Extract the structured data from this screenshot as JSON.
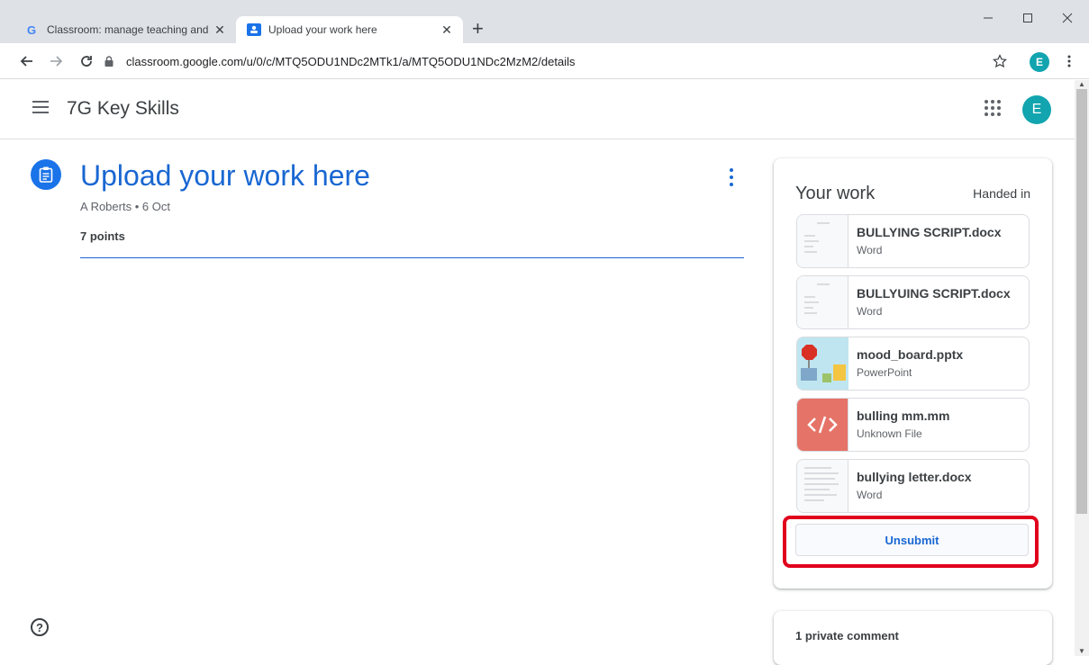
{
  "browser": {
    "tabs": [
      {
        "title": "Classroom: manage teaching and",
        "icon": "google-icon"
      },
      {
        "title": "Upload your work here",
        "icon": "classroom-icon"
      }
    ],
    "new_tab": "+",
    "url": "classroom.google.com/u/0/c/MTQ5ODU1NDc2MTk1/a/MTQ5ODU1NDc2MzM2/details",
    "profile_initial": "E"
  },
  "header": {
    "course_name": "7G Key Skills",
    "avatar_initial": "E"
  },
  "assignment": {
    "title": "Upload your work here",
    "meta": "A Roberts • 6 Oct",
    "points": "7 points"
  },
  "your_work": {
    "title": "Your work",
    "status": "Handed in",
    "files": [
      {
        "name": "BULLYING SCRIPT.docx",
        "type": "Word"
      },
      {
        "name": "BULLYUING SCRIPT.docx",
        "type": "Word"
      },
      {
        "name": "mood_board.pptx",
        "type": "PowerPoint"
      },
      {
        "name": "bulling mm.mm",
        "type": "Unknown File"
      },
      {
        "name": "bullying letter.docx",
        "type": "Word"
      }
    ],
    "unsubmit_label": "Unsubmit"
  },
  "comments": {
    "label": "1 private comment"
  },
  "colors": {
    "accent": "#1967d2",
    "avatar": "#12a4af",
    "highlight": "#e0001b"
  }
}
